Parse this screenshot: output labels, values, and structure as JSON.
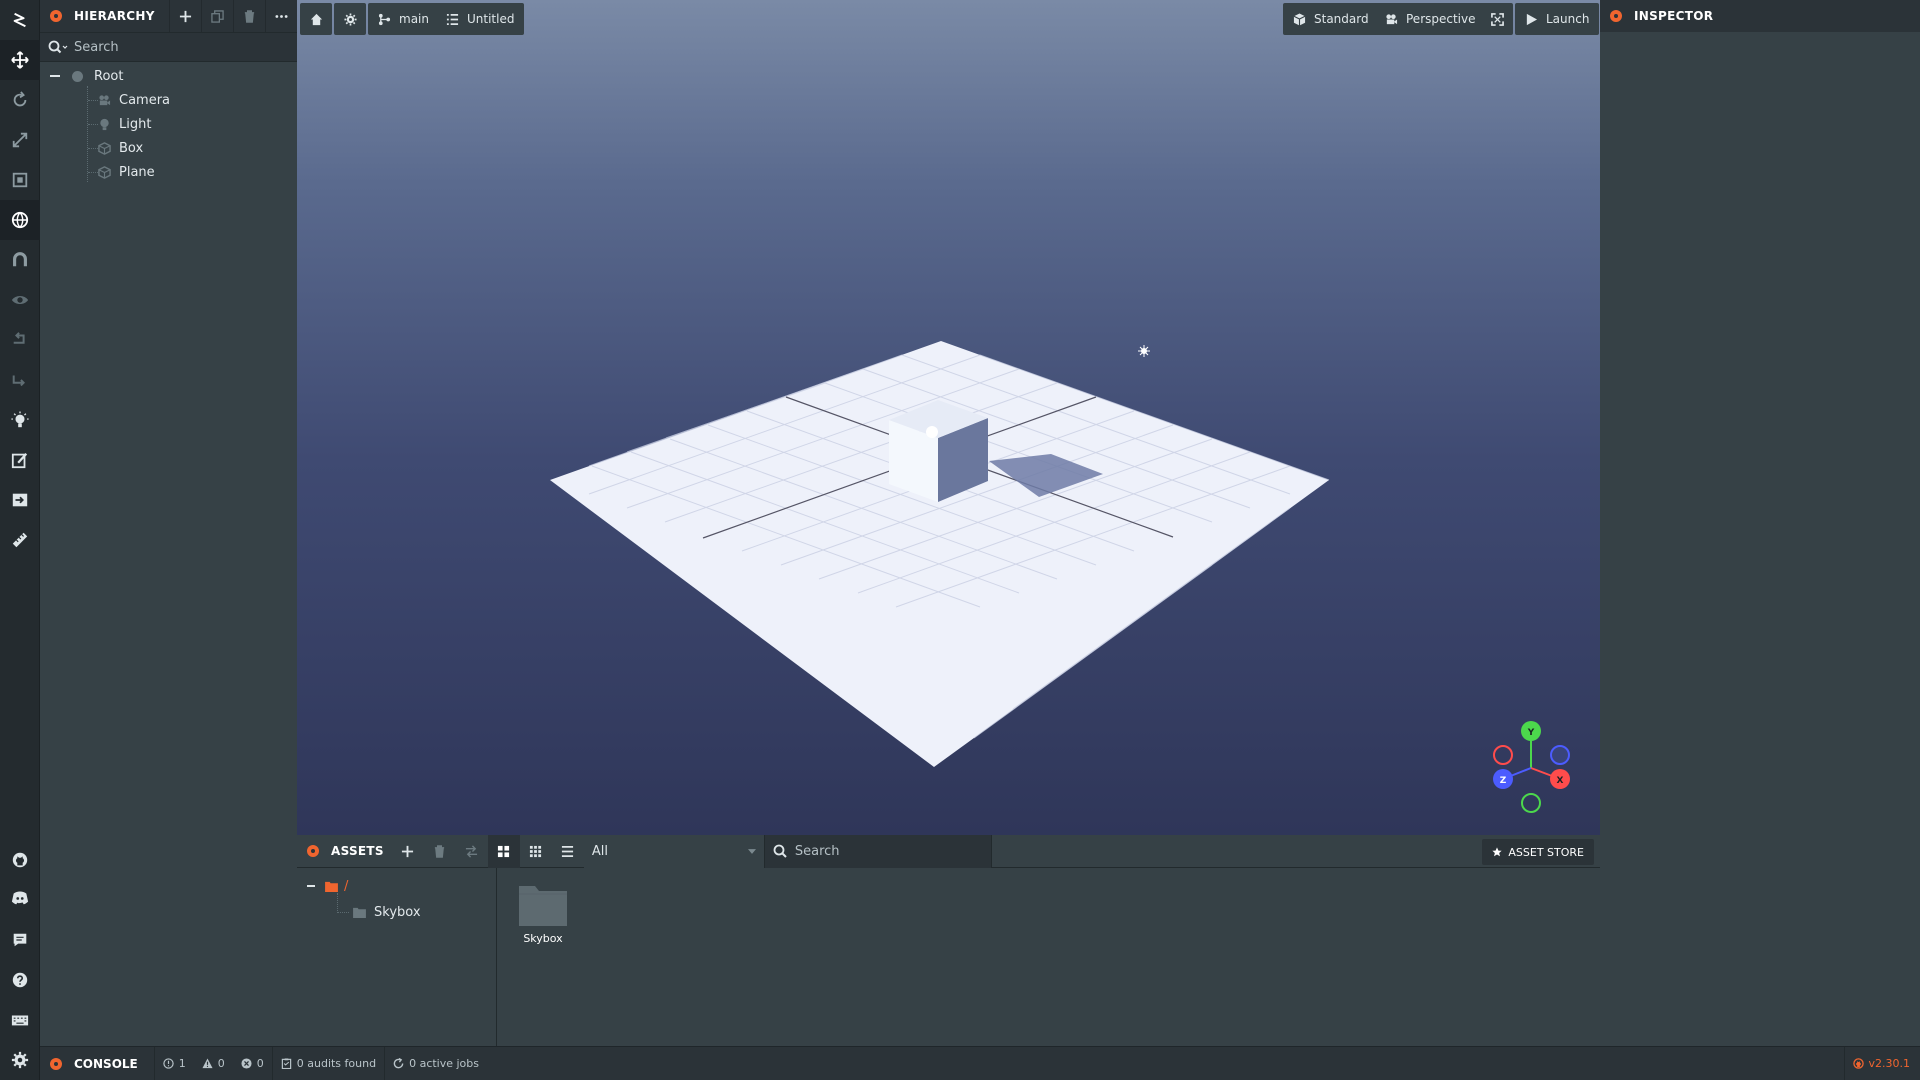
{
  "hierarchy": {
    "title": "HIERARCHY",
    "search_placeholder": "Search",
    "items": [
      {
        "label": "Root"
      },
      {
        "label": "Camera"
      },
      {
        "label": "Light"
      },
      {
        "label": "Box"
      },
      {
        "label": "Plane"
      }
    ]
  },
  "viewport": {
    "toolbar": {
      "branch_label": "main",
      "scene_label": "Untitled",
      "render_mode_label": "Standard",
      "camera_label": "Perspective",
      "launch_label": "Launch"
    },
    "gizmo": {
      "y": "Y",
      "x": "X",
      "z": "Z"
    }
  },
  "assets": {
    "title": "ASSETS",
    "filter_value": "All",
    "search_placeholder": "Search",
    "store_label": "ASSET STORE",
    "tree": {
      "root_label": "/",
      "child_label": "Skybox"
    },
    "items": [
      {
        "label": "Skybox"
      }
    ]
  },
  "inspector": {
    "title": "INSPECTOR"
  },
  "statusbar": {
    "console_label": "CONSOLE",
    "info_count": "1",
    "warning_count": "0",
    "error_count": "0",
    "audits_label": "0 audits found",
    "jobs_label": "0 active jobs",
    "version_label": "v2.30.1"
  },
  "colors": {
    "accent": "#f0652f",
    "panel": "#364146",
    "panel_dark": "#2b3338",
    "toolbar": "#242b2f"
  }
}
